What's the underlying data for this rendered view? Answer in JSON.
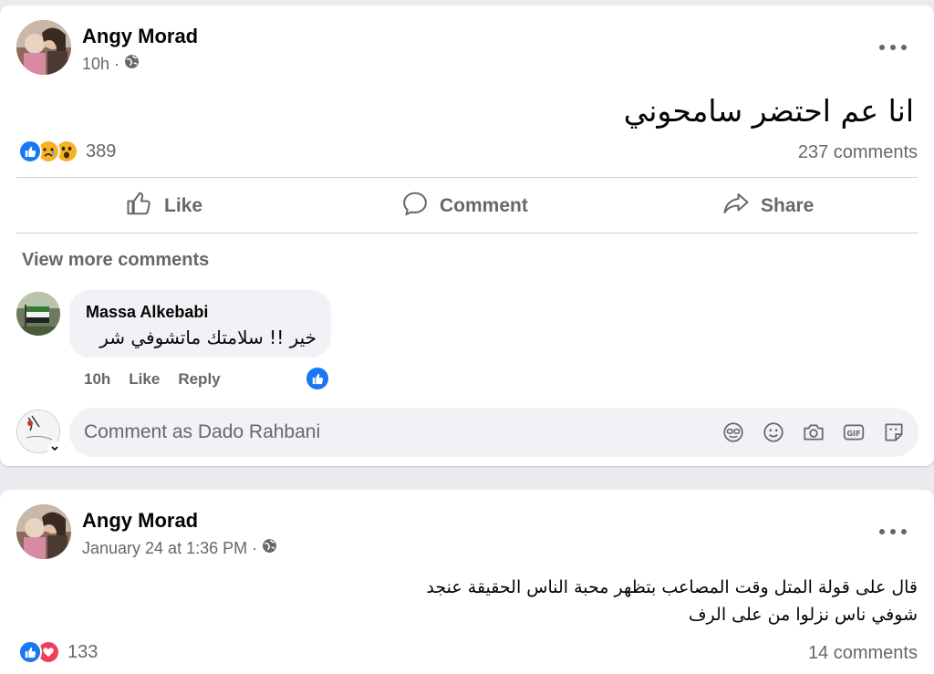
{
  "post1": {
    "author": "Angy Morad",
    "time": "10h ·",
    "text": "انا عم احتضر سامحوني",
    "reaction_count": "389",
    "comments_count": "237 comments",
    "actions": {
      "like": "Like",
      "comment": "Comment",
      "share": "Share"
    },
    "view_more": "View more comments",
    "comment": {
      "author": "Massa Alkebabi",
      "text": "خير !! سلامتك ماتشوفي شر",
      "time": "10h",
      "like": "Like",
      "reply": "Reply"
    },
    "composer_placeholder": "Comment as Dado Rahbani"
  },
  "post2": {
    "author": "Angy Morad",
    "time": "January 24 at 1:36 PM ·",
    "text_line1": "قال على قولة المتل وقت المصاعب بتظهر محبة الناس الحقيقة عنجد",
    "text_line2": "شوفي ناس نزلوا من على الرف",
    "reaction_count": "133",
    "comments_count": "14 comments"
  },
  "colors": {
    "like_blue": "#1877f2",
    "love_red": "#f33e58",
    "haha_yellow": "#f7b125",
    "muted_text": "#65676b"
  },
  "icons": [
    "globe-icon",
    "like-icon",
    "comment-icon",
    "share-icon",
    "more-icon",
    "emoji-icon",
    "camera-icon",
    "gif-icon",
    "sticker-icon",
    "avatar-sticker-icon"
  ]
}
